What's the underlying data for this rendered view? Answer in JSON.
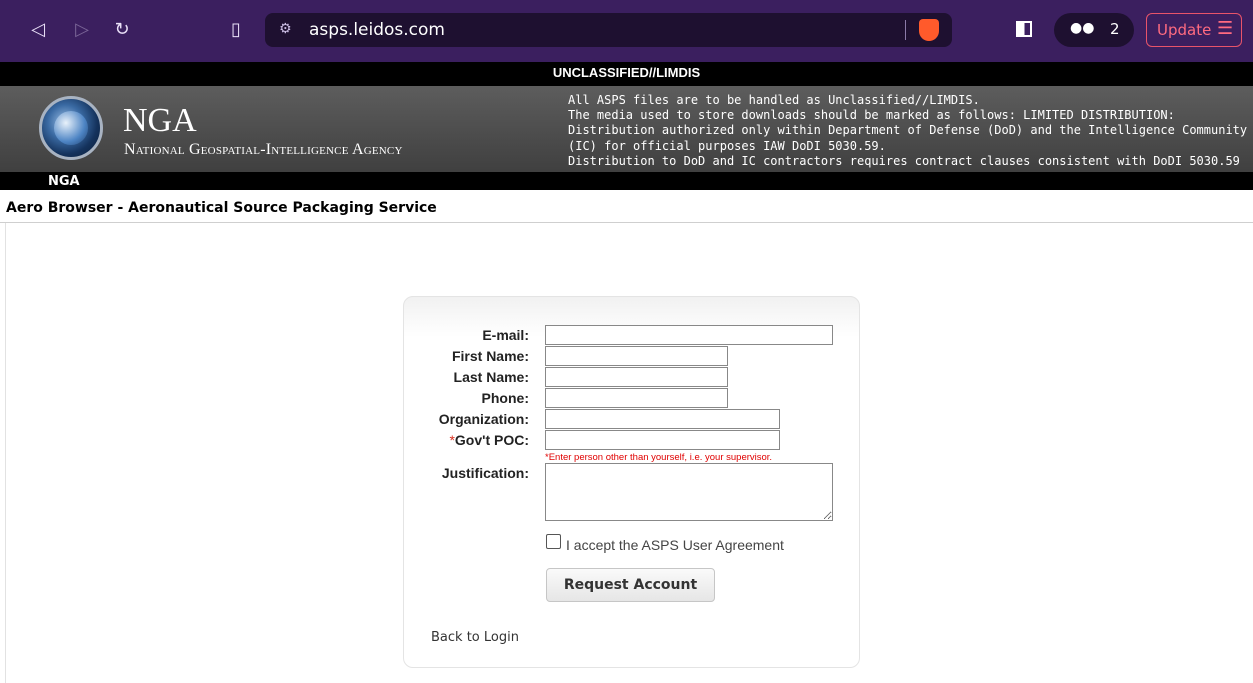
{
  "browser": {
    "url": "asps.leidos.com",
    "vpn_count": "2",
    "update_label": "Update"
  },
  "banner": {
    "classification": "UNCLASSIFIED//LIMDIS",
    "agency_short": "NGA",
    "agency_full": "National Geospatial-Intelligence Agency",
    "notice_lines": [
      "All ASPS files are to be handled as Unclassified//LIMDIS.",
      "The media used to store downloads should be marked as follows: LIMITED DISTRIBUTION:",
      "Distribution authorized only within Department of Defense (DoD) and the Intelligence Community",
      "(IC) for official purposes IAW DoDI 5030.59.",
      "Distribution to DoD and IC contractors requires contract clauses consistent with DoDI 5030.59"
    ],
    "nav_tab": "NGA",
    "app_title": "Aero Browser - Aeronautical Source Packaging Service"
  },
  "form": {
    "email_label": "E-mail:",
    "first_name_label": "First Name:",
    "last_name_label": "Last Name:",
    "phone_label": "Phone:",
    "organization_label": "Organization:",
    "gov_poc_required_mark": "*",
    "gov_poc_label": "Gov't POC:",
    "gov_poc_hint": "*Enter person other than yourself, i.e. your supervisor.",
    "justification_label": "Justification:",
    "agreement_label": "I accept the ASPS User Agreement",
    "submit_label": "Request Account",
    "back_link": "Back to Login"
  }
}
